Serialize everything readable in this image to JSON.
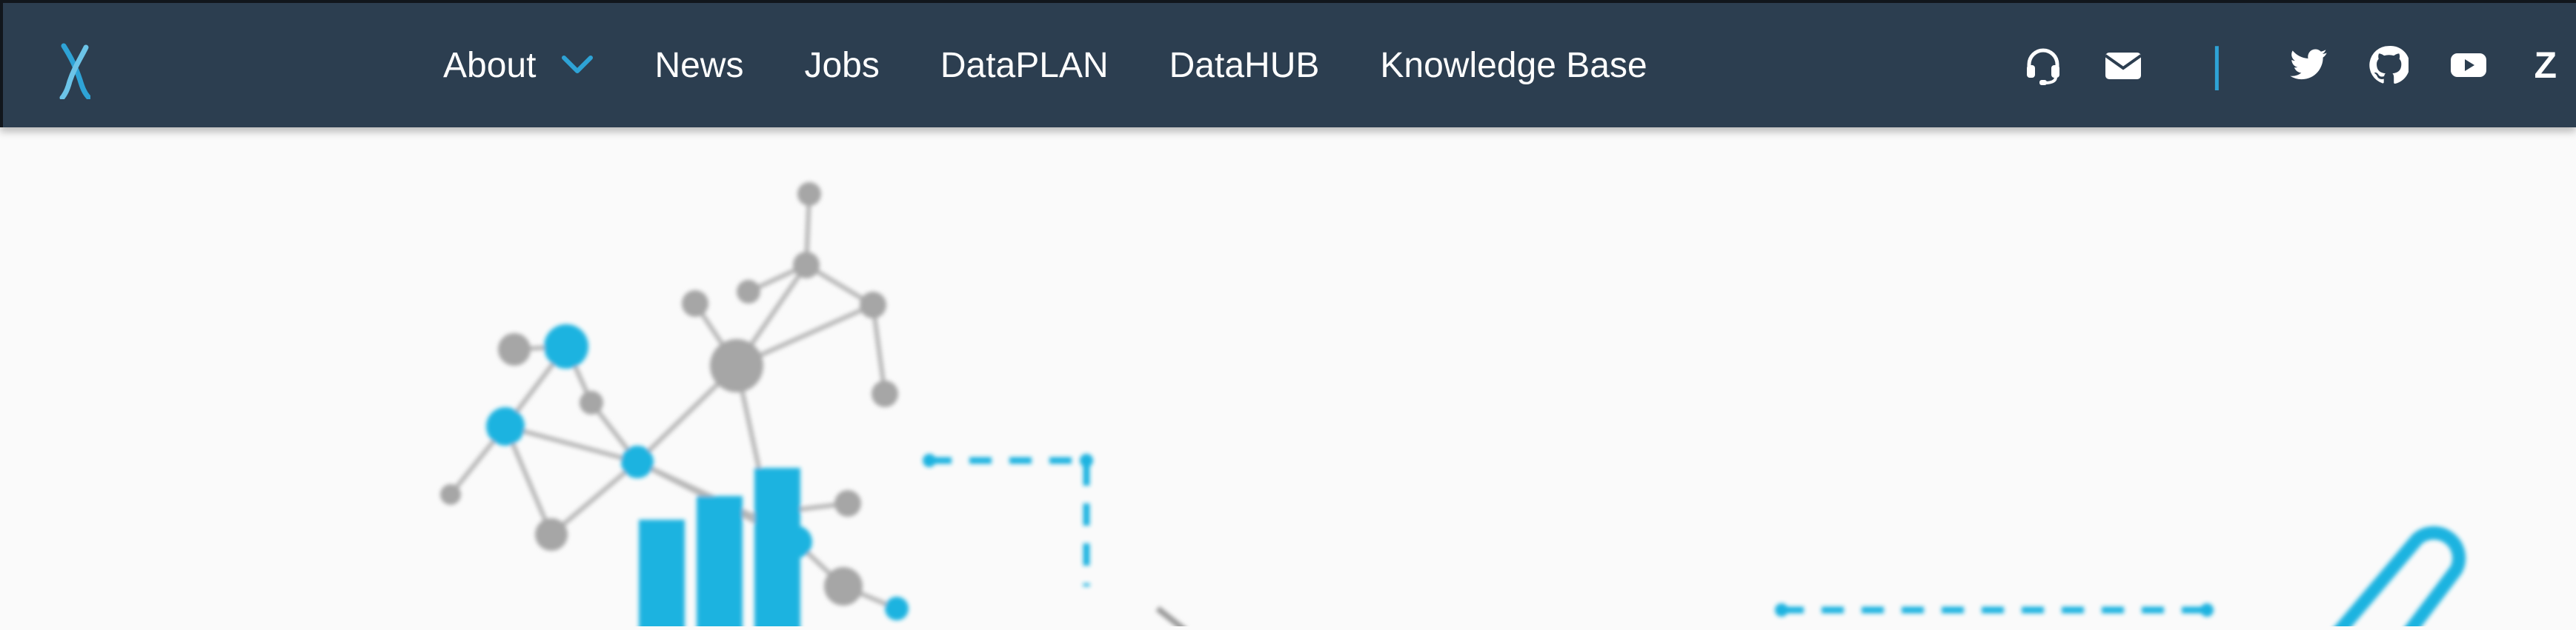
{
  "navbar": {
    "logo_icon": "sandcastle-x-logo-icon",
    "items": [
      {
        "label": "About",
        "has_dropdown": true
      },
      {
        "label": "News"
      },
      {
        "label": "Jobs"
      },
      {
        "label": "DataPLAN"
      },
      {
        "label": "DataHUB"
      },
      {
        "label": "Knowledge Base"
      }
    ],
    "right_icons": [
      "headset-icon",
      "envelope-icon",
      "twitter-icon",
      "github-icon",
      "youtube-icon"
    ],
    "divider": "|",
    "zulip_label": "Z"
  },
  "colors": {
    "navbar_bg": "#2c3e50",
    "accent": "#2ea3d6",
    "hero_bg": "#fafafa",
    "network_gray": "#a6a6a6",
    "network_blue": "#1eb3e0"
  }
}
